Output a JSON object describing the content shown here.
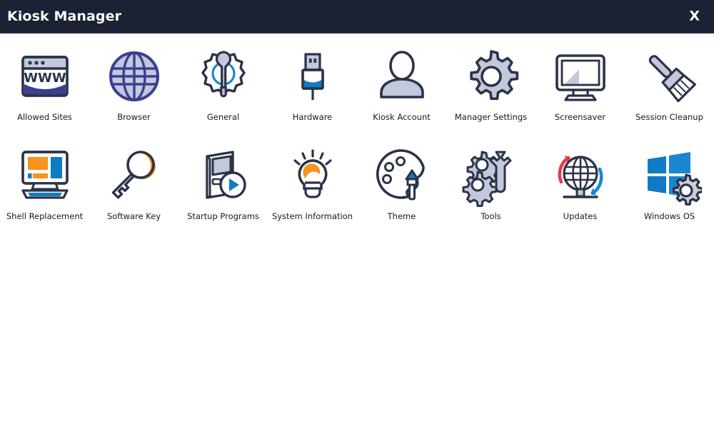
{
  "window": {
    "title": "Kiosk Manager",
    "close_label": "X",
    "titlebar_color": "#1b2233",
    "background_color": "#ffffff"
  },
  "palette": {
    "outline_dark": "#2a3347",
    "fill_lavender": "#c3c8dd",
    "indigo": "#3b3f8f",
    "blue": "#0f7bc4",
    "blue_bright": "#1a86d0",
    "orange": "#f7931e",
    "red": "#e63946",
    "gray_fill": "#c9ced8"
  },
  "grid": {
    "columns": 8,
    "items": [
      {
        "id": "allowed-sites",
        "label": "Allowed Sites",
        "icon": "browser-window-www-icon"
      },
      {
        "id": "browser",
        "label": "Browser",
        "icon": "globe-icon"
      },
      {
        "id": "general",
        "label": "General",
        "icon": "gear-wrench-icon"
      },
      {
        "id": "hardware",
        "label": "Hardware",
        "icon": "usb-connector-icon"
      },
      {
        "id": "kiosk-account",
        "label": "Kiosk Account",
        "icon": "user-person-icon"
      },
      {
        "id": "manager-settings",
        "label": "Manager Settings",
        "icon": "gear-icon"
      },
      {
        "id": "screensaver",
        "label": "Screensaver",
        "icon": "monitor-icon"
      },
      {
        "id": "session-cleanup",
        "label": "Session Cleanup",
        "icon": "brush-icon"
      },
      {
        "id": "shell-replacement",
        "label": "Shell Replacement",
        "icon": "desktop-layout-icon"
      },
      {
        "id": "software-key",
        "label": "Software Key",
        "icon": "key-icon"
      },
      {
        "id": "startup-programs",
        "label": "Startup Programs",
        "icon": "kiosk-play-icon"
      },
      {
        "id": "system-information",
        "label": "System Information",
        "icon": "lightbulb-icon"
      },
      {
        "id": "theme",
        "label": "Theme",
        "icon": "palette-brush-icon"
      },
      {
        "id": "tools",
        "label": "Tools",
        "icon": "gears-wrench-icon"
      },
      {
        "id": "updates",
        "label": "Updates",
        "icon": "globe-refresh-icon"
      },
      {
        "id": "windows-os",
        "label": "Windows OS",
        "icon": "windows-logo-gear-icon"
      }
    ]
  }
}
